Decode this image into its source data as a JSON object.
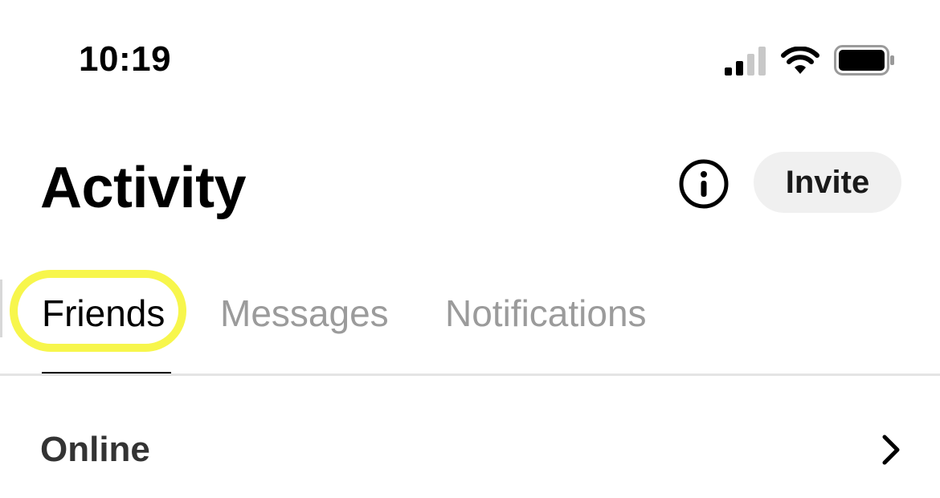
{
  "status_bar": {
    "time": "10:19",
    "icons": [
      "signal-icon",
      "wifi-icon",
      "battery-icon"
    ]
  },
  "header": {
    "title": "Activity",
    "info_icon": "info-icon",
    "invite_label": "Invite"
  },
  "tabs": {
    "items": [
      {
        "label": "Friends",
        "active": true
      },
      {
        "label": "Messages",
        "active": false
      },
      {
        "label": "Notifications",
        "active": false
      }
    ],
    "highlight_color": "#f7f64c"
  },
  "section": {
    "label": "Online",
    "chevron_icon": "chevron-right-icon"
  },
  "colors": {
    "active_tab": "#000000",
    "inactive_tab": "#9b9b9b",
    "invite_bg": "#f0f0f0"
  }
}
